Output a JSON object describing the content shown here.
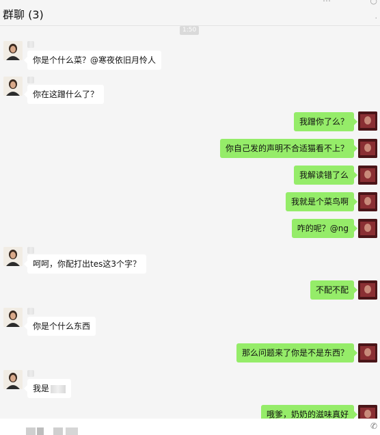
{
  "header": {
    "title": "群聊 (3)",
    "icons": [
      "more-icon",
      "add-icon"
    ]
  },
  "chat": {
    "timestamp": "1:50",
    "messages": [
      {
        "side": "left",
        "text": "你是个什么菜？@寒夜依旧月怜人"
      },
      {
        "side": "left",
        "text": "你在这蹭什么了？"
      },
      {
        "side": "right",
        "text": "我蹭你了么？"
      },
      {
        "side": "right",
        "text": "你自己发的声明不合适猫看不上？"
      },
      {
        "side": "right",
        "text": "我解读错了么"
      },
      {
        "side": "right",
        "text": "我就是个菜鸟啊"
      },
      {
        "side": "right",
        "text": "咋的呢？@ng"
      },
      {
        "side": "left",
        "text": "呵呵，你配打出tes这3个字？"
      },
      {
        "side": "right",
        "text": "不配不配"
      },
      {
        "side": "left",
        "text": "你是个什么东西"
      },
      {
        "side": "right",
        "text": "那么问题来了你是不是东西？"
      },
      {
        "side": "left",
        "text": "我是"
      },
      {
        "side": "right",
        "text": "哦爹，奶奶的滋味真好"
      }
    ]
  },
  "footer": {
    "icons": [
      "phone-icon"
    ]
  },
  "colors": {
    "background": "#f5f5f5",
    "bubble_self": "#95ec69",
    "bubble_other": "#ffffff"
  }
}
